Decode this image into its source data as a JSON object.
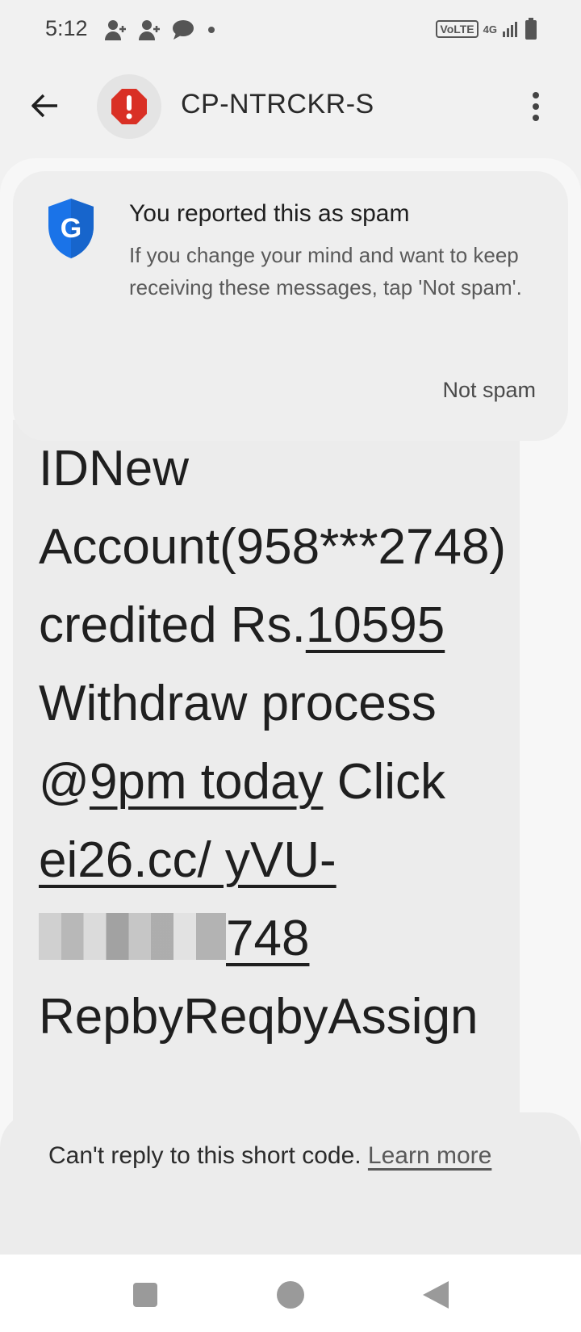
{
  "status_bar": {
    "time": "5:12",
    "icons": [
      "person-add-icon",
      "person-add-icon",
      "chat-bubble-icon",
      "dot-icon"
    ],
    "right": {
      "volte": "VoLTE",
      "network": "4G",
      "icons": [
        "signal-icon",
        "battery-icon"
      ]
    }
  },
  "header": {
    "title": "CP-NTRCKR-S",
    "avatar_icon": "spam-alert-icon",
    "avatar_color": "#d93025"
  },
  "spam_notice": {
    "title": "You reported this as spam",
    "description": "If you change your mind and want to keep receiving these messages, tap 'Not spam'.",
    "action": "Not spam",
    "shield_color": "#1a73e8"
  },
  "message": {
    "t1": "IDNew Account(958***2748) credited Rs.",
    "amount": "10595",
    "t2": " Withdraw process @",
    "when": "9pm today",
    "t3": " Click ",
    "link_start": "ei26.cc/ yVU-",
    "link_end": "748",
    "t4": " RepbyReqbyAssign"
  },
  "footer": {
    "text": "Can't reply to this short code. ",
    "learn_more": "Learn more"
  }
}
